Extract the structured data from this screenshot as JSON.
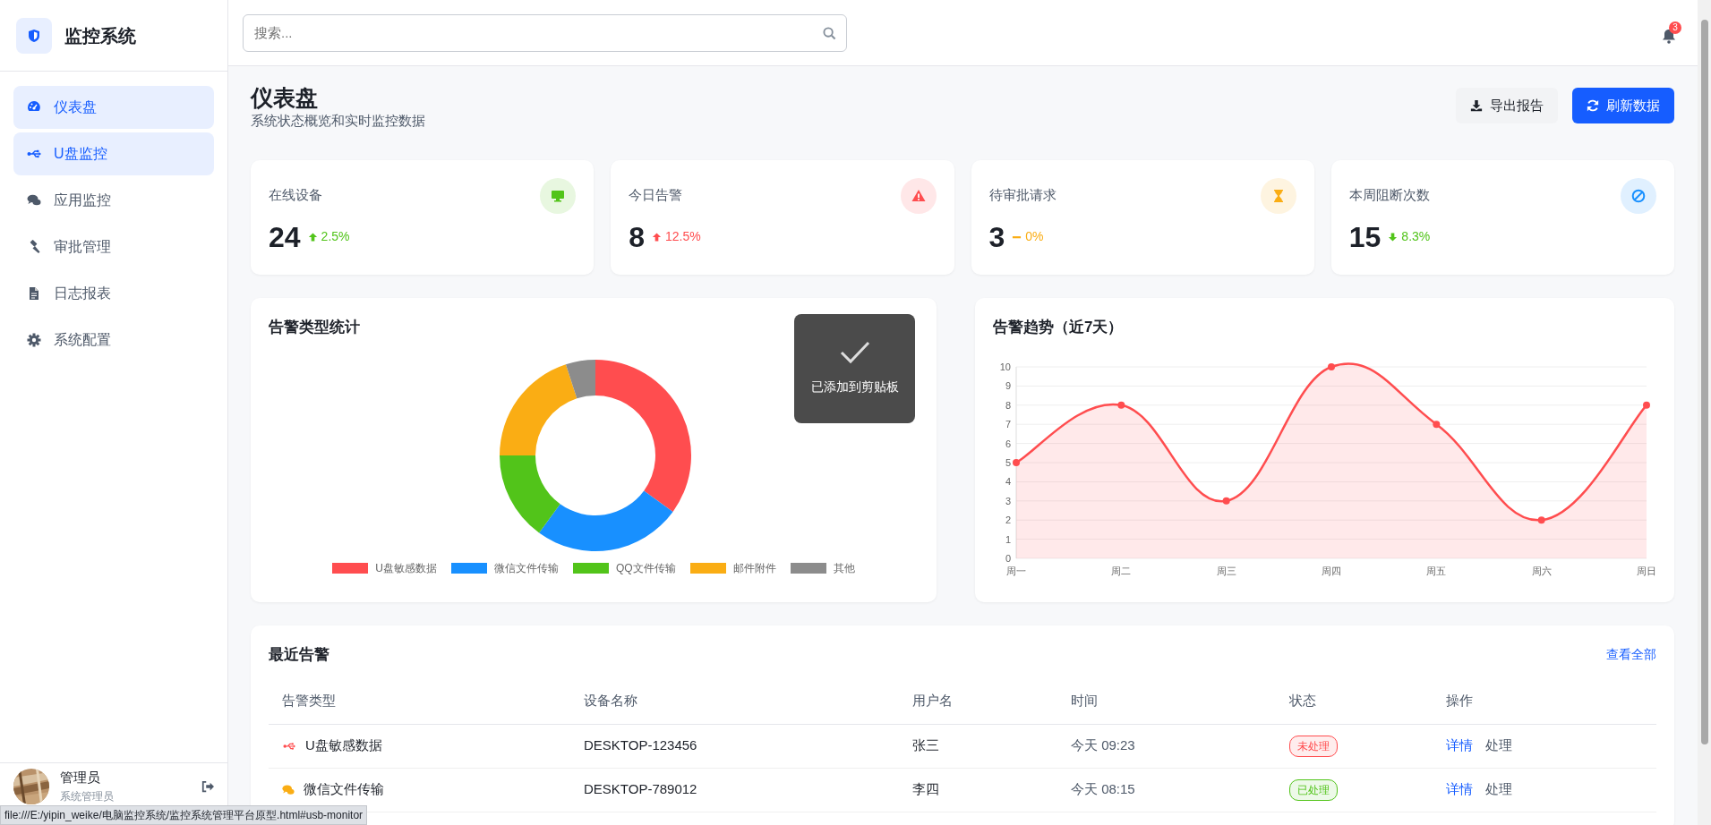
{
  "sidebar": {
    "logo_text": "监控系统",
    "items": [
      {
        "label": "仪表盘",
        "selected": true
      },
      {
        "label": "U盘监控",
        "selected": true
      },
      {
        "label": "应用监控",
        "selected": false
      },
      {
        "label": "审批管理",
        "selected": false
      },
      {
        "label": "日志报表",
        "selected": false
      },
      {
        "label": "系统配置",
        "selected": false
      }
    ],
    "user": {
      "name": "管理员",
      "role": "系统管理员"
    }
  },
  "topbar": {
    "search": {
      "placeholder": "搜索..."
    },
    "notification_count": "3"
  },
  "page": {
    "title": "仪表盘",
    "subtitle": "系统状态概览和实时监控数据",
    "buttons": [
      {
        "label": "导出报告",
        "kind": "secondary"
      },
      {
        "label": "刷新数据",
        "kind": "primary"
      }
    ]
  },
  "stats": [
    {
      "label": "在线设备",
      "value": "24",
      "icon": {
        "color": "#52c41a"
      },
      "change": {
        "text": "2.5%",
        "kind": "up",
        "color": "#52c41a"
      }
    },
    {
      "label": "今日告警",
      "value": "8",
      "icon": {
        "color": "#ff4d4f"
      },
      "change": {
        "text": "12.5%",
        "kind": "up",
        "color": "#ff4d4f"
      }
    },
    {
      "label": "待审批请求",
      "value": "3",
      "icon": {
        "color": "#faad14"
      },
      "change": {
        "text": "0%",
        "kind": "flat",
        "color": "#faad14"
      }
    },
    {
      "label": "本周阻断次数",
      "value": "15",
      "icon": {
        "color": "#1890ff"
      },
      "change": {
        "text": "8.3%",
        "kind": "down",
        "color": "#52c41a"
      }
    }
  ],
  "type_chart": {
    "title": "告警类型统计",
    "chart_data": {
      "type": "donut",
      "categories": [
        "U盘敏感数据",
        "微信文件传输",
        "QQ文件传输",
        "邮件附件",
        "其他"
      ],
      "values": [
        35,
        25,
        15,
        20,
        5
      ],
      "colors": [
        "#ff4d4f",
        "#1890ff",
        "#52c41a",
        "#faad14",
        "#8c8c8c"
      ]
    }
  },
  "toast": {
    "text": "已添加到剪贴板"
  },
  "trend_chart": {
    "title": "告警趋势（近7天）",
    "chart_data": {
      "type": "area",
      "categories": [
        "周一",
        "周二",
        "周三",
        "周四",
        "周五",
        "周六",
        "周日"
      ],
      "series": [
        {
          "color": "#ff4d4f",
          "values": [
            5,
            8,
            3,
            10,
            7,
            2,
            8
          ]
        }
      ],
      "grid": true,
      "ylim": [
        0,
        10
      ],
      "yticks": [
        0,
        1,
        2,
        3,
        4,
        5,
        6,
        7,
        8,
        9,
        10
      ]
    }
  },
  "recent_alerts": {
    "title": "最近告警",
    "link": "查看全部",
    "columns": [
      "告警类型",
      "设备名称",
      "用户名",
      "时间",
      "状态",
      "操作"
    ],
    "rows": [
      {
        "kind": "usb",
        "type": "U盘敏感数据",
        "device": "DESKTOP-123456",
        "user": "张三",
        "time": "今天 09:23",
        "status": {
          "text": "未处理",
          "color": "#ff4d4f"
        },
        "actions": [
          "详情",
          "处理"
        ]
      },
      {
        "kind": "chat",
        "type": "微信文件传输",
        "device": "DESKTOP-789012",
        "user": "李四",
        "time": "今天 08:15",
        "status": {
          "text": "已处理",
          "color": "#52c41a"
        },
        "actions": [
          "详情",
          "处理"
        ]
      }
    ]
  },
  "status_bar": {
    "url": "file:///E:/yipin_weike/电脑监控系统/监控系统管理平台原型.html#usb-monitor"
  }
}
